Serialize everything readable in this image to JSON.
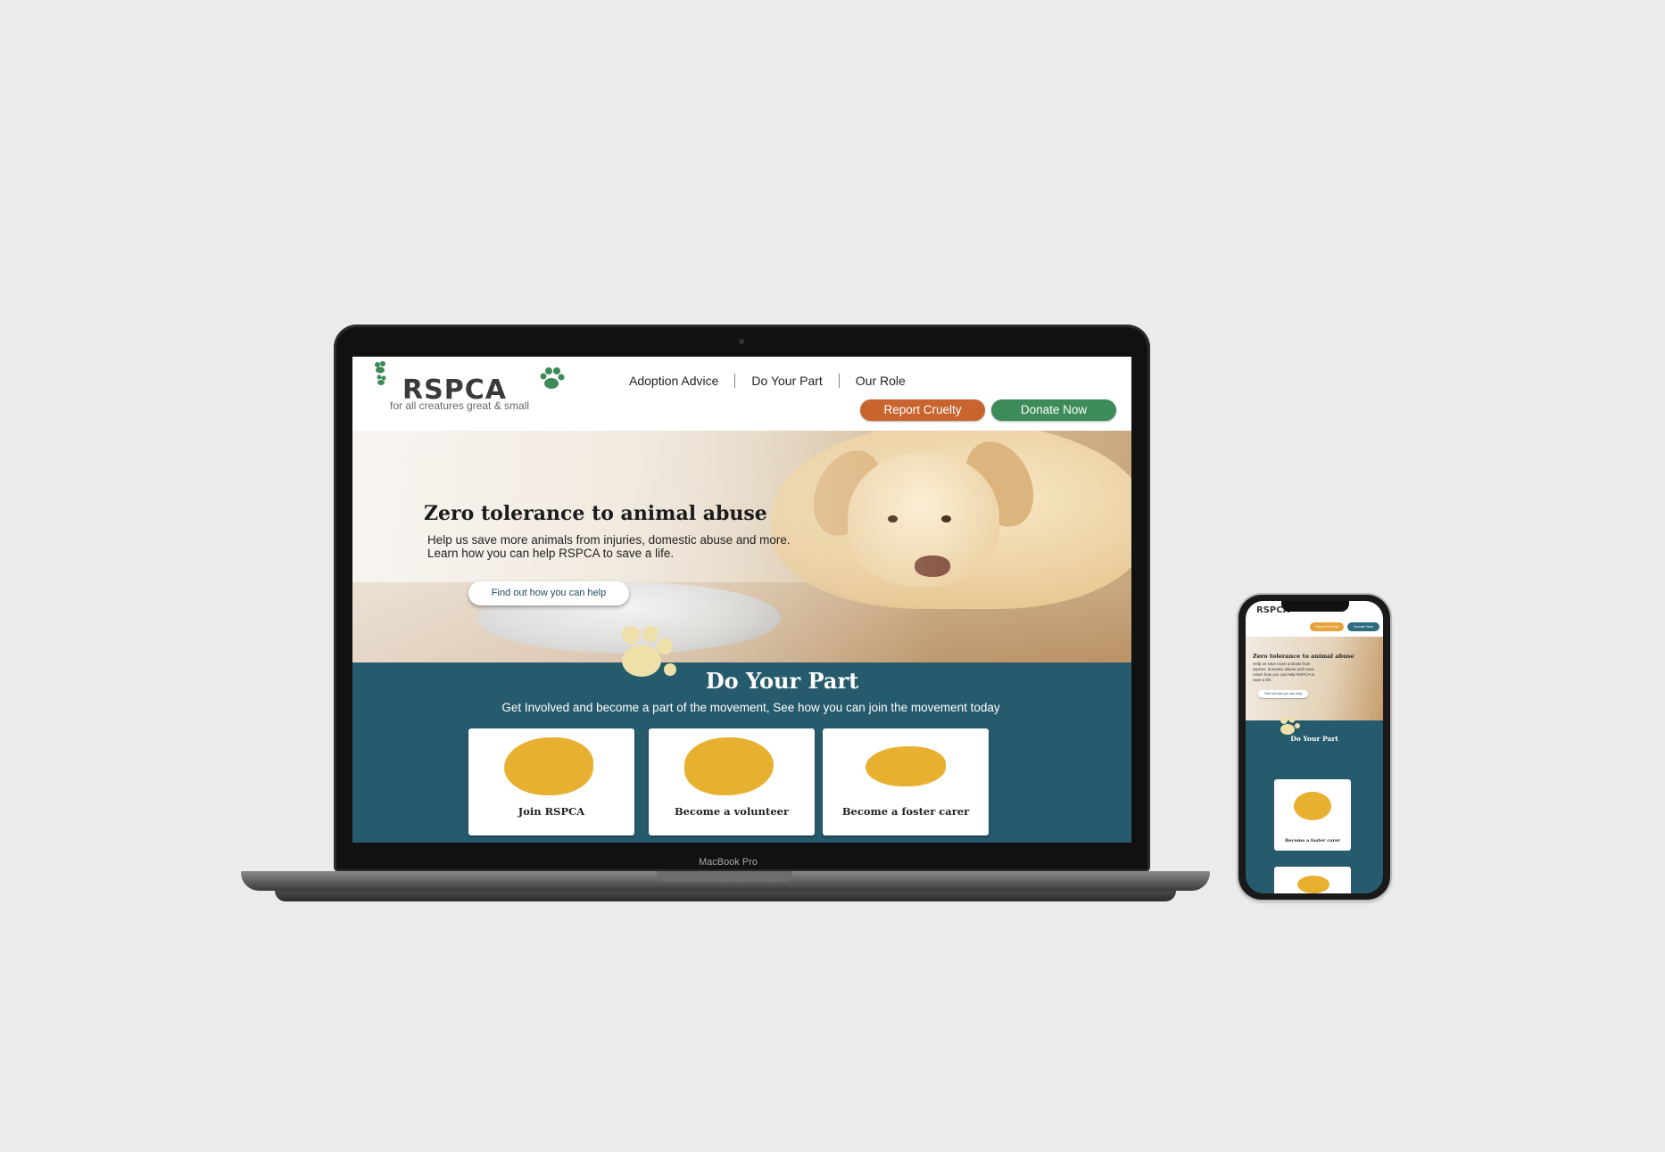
{
  "laptop": {
    "device_label": "MacBook Pro"
  },
  "site": {
    "logo": {
      "name": "RSPCA",
      "tagline": "for all creatures great & small"
    },
    "nav": [
      {
        "label": "Adoption Advice"
      },
      {
        "label": "Do Your Part"
      },
      {
        "label": "Our Role"
      }
    ],
    "buttons": {
      "report": "Report Cruelty",
      "donate": "Donate Now"
    },
    "hero": {
      "title": "Zero tolerance to animal abuse",
      "text": "Help us save more animals from injuries, domestic abuse and more. Learn how you can help RSPCA to save a life.",
      "cta": "Find out how you can help"
    },
    "do_your_part": {
      "title": "Do Your Part",
      "subtitle": "Get Involved and become a part of the movement, See how you can join the movement today",
      "cards": [
        {
          "label": "Join RSPCA",
          "icon": "europe-map-icon"
        },
        {
          "label": "Become a volunteer",
          "icon": "volunteer-hands-icon"
        },
        {
          "label": "Become a foster carer",
          "icon": "globe-icon"
        }
      ]
    }
  },
  "phone": {
    "logo": "RSPCA",
    "buttons": {
      "report": "Report Cruelty",
      "donate": "Donate Now"
    },
    "hero": {
      "title": "Zero tolerance to animal abuse",
      "text": "Help us save more animals from injuries, domestic abuse and more. Learn how you can help RSPCA to save a life.",
      "cta": "Find out how you can help"
    },
    "section_title": "Do Your Part",
    "card_label": "Become a foster carer"
  },
  "colors": {
    "background": "#ebebeb",
    "teal": "#255b6d",
    "report_orange": "#c8642e",
    "donate_green": "#3e8b5a",
    "accent_yellow": "#e8b030",
    "paw_green": "#3e8b5a",
    "paw_cream": "#ede0a8"
  }
}
